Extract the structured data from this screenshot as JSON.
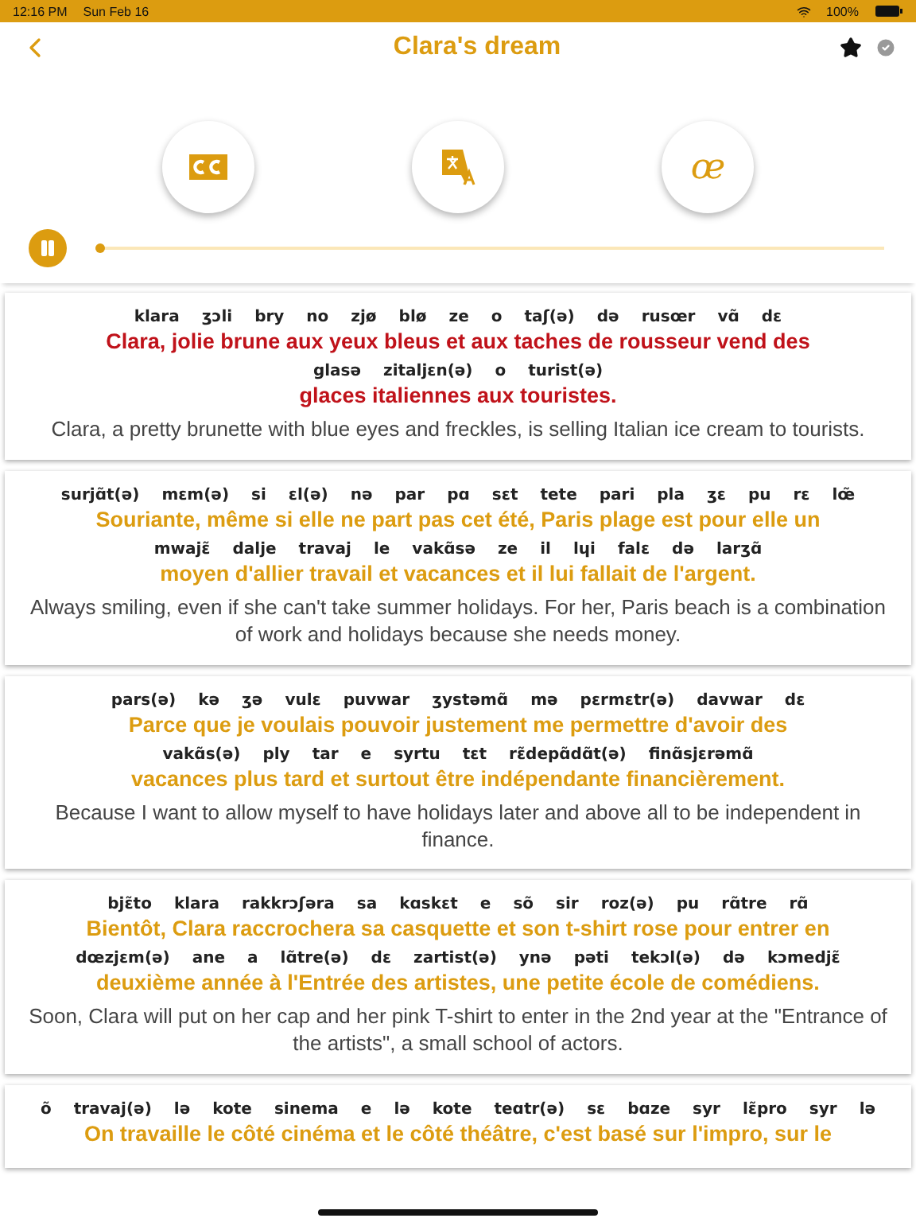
{
  "status_bar": {
    "time": "12:16 PM",
    "date": "Sun Feb 16",
    "battery": "100%"
  },
  "nav": {
    "title": "Clara's dream",
    "favorite": true,
    "done": false
  },
  "modes": [
    {
      "kind": "captions"
    },
    {
      "kind": "translate"
    },
    {
      "kind": "phonetic",
      "label": "œ"
    }
  ],
  "player": {
    "playing": true,
    "level": 0
  },
  "paragraphs": [
    {
      "active": true,
      "lines": [
        {
          "phonetics": [
            "klara",
            "ʒɔli",
            "bry",
            "no",
            "zjø",
            "blø",
            "ze",
            "o",
            "taʃ(ə)",
            "də",
            "rusœr",
            "vɑ̃",
            "dɛ"
          ],
          "text": "Clara, jolie brune aux yeux bleus et aux taches de rousseur vend des"
        },
        {
          "phonetics": [
            "glasə",
            "zitaljɛn(ə)",
            "o",
            "turist(ə)"
          ],
          "text": "glaces italiennes aux touristes."
        }
      ],
      "translation": "Clara, a pretty brunette with blue eyes and freckles, is selling Italian ice cream to tourists."
    },
    {
      "active": false,
      "lines": [
        {
          "phonetics": [
            "surjɑ̃t(ə)",
            "mɛm(ə)",
            "si",
            "ɛl(ə)",
            "nə",
            "par",
            "pɑ",
            "sɛt",
            "tete",
            "pari",
            "pla",
            "ʒɛ",
            "pu",
            "rɛ",
            "lœ̃"
          ],
          "text": "Souriante, même si elle ne part pas cet été, Paris plage est pour elle un"
        },
        {
          "phonetics": [
            "mwajɛ̃",
            "dalje",
            "travaj",
            "le",
            "vakɑ̃sə",
            "ze",
            "il",
            "lɥi",
            "falɛ",
            "də",
            "larʒɑ̃"
          ],
          "text": "moyen d'allier travail et vacances et il lui fallait de l'argent."
        }
      ],
      "translation": "Always smiling, even if she can't take summer holidays. For her, Paris beach is a combination of work and holidays because she needs money."
    },
    {
      "active": false,
      "lines": [
        {
          "phonetics": [
            "pars(ə)",
            "kə",
            "ʒə",
            "vulɛ",
            "puvwar",
            "ʒystəmɑ̃",
            "mə",
            "pɛrmɛtr(ə)",
            "davwar",
            "dɛ"
          ],
          "text": "Parce que je voulais pouvoir justement me permettre d'avoir des"
        },
        {
          "phonetics": [
            "vakɑ̃s(ə)",
            "ply",
            "tar",
            "e",
            "syrtu",
            "tɛt",
            "rɛ̃depɑ̃dɑ̃t(ə)",
            "finɑ̃sjɛrəmɑ̃"
          ],
          "text": "vacances plus tard et surtout être indépendante financièrement."
        }
      ],
      "translation": "Because I want to allow myself to have holidays later and above all to be independent in finance."
    },
    {
      "active": false,
      "lines": [
        {
          "phonetics": [
            "bjɛ̃to",
            "klara",
            "rakkrɔʃəra",
            "sa",
            "kɑskɛt",
            "e",
            "sõ",
            "sir",
            "roz(ə)",
            "pu",
            "rɑ̃tre",
            "rɑ̃"
          ],
          "text": "Bientôt, Clara raccrochera sa casquette et son t-shirt rose pour entrer en"
        },
        {
          "phonetics": [
            "dœzjɛm(ə)",
            "ane",
            "a",
            "lɑ̃tre(ə)",
            "dɛ",
            "zartist(ə)",
            "ynə",
            "pəti",
            "tekɔl(ə)",
            "də",
            "kɔmedjɛ̃"
          ],
          "text": "deuxième année à l'Entrée des artistes, une petite école de comédiens."
        }
      ],
      "translation": "Soon, Clara will put on her cap and her pink T-shirt to enter in the 2nd year at the \"Entrance of the artists\", a small school of actors."
    },
    {
      "active": false,
      "lines": [
        {
          "phonetics": [
            "õ",
            "travaj(ə)",
            "lə",
            "kote",
            "sinema",
            "e",
            "lə",
            "kote",
            "teɑtr(ə)",
            "sɛ",
            "bɑze",
            "syr",
            "lɛ̃pro",
            "syr",
            "lə"
          ],
          "text": "On travaille le côté cinéma et le côté théâtre, c'est basé sur l'impro, sur le"
        }
      ]
    }
  ]
}
